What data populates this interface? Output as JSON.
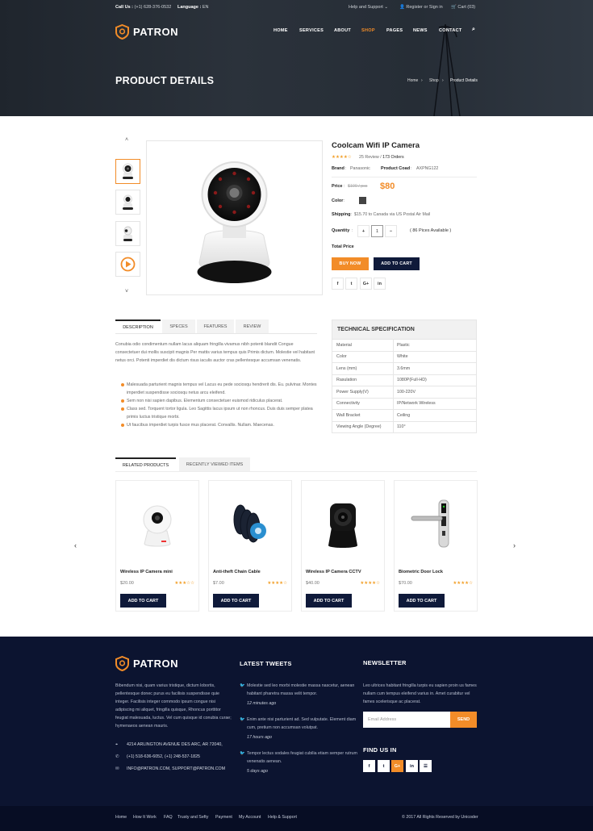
{
  "topbar": {
    "call_label": "Call Us :",
    "call_number": "(+1) 628-376-0532",
    "language_label": "Language :",
    "language_value": "EN",
    "help": "Help and Support",
    "account": "Register or Sign in",
    "cart": "Cart (03)"
  },
  "brand": {
    "name": "PATRON",
    "accent": "#f28c28",
    "navy": "#0c1430"
  },
  "nav": {
    "items": [
      "HOME",
      "SERVICES",
      "ABOUT",
      "SHOP",
      "PAGES",
      "NEWS",
      "CONTACT"
    ],
    "active": "SHOP"
  },
  "hero": {
    "title": "PRODUCT DETAILS",
    "breadcrumb": [
      "Home",
      "Shop",
      "Product Details"
    ]
  },
  "product": {
    "title": "Coolcam Wifi IP Camera",
    "rating": 4,
    "reviews": "25 Review",
    "orders": "173 Orders",
    "brand_label": "Brand",
    "brand_value": "Panasonic",
    "code_label": "Product Coad",
    "code_value": "AXPNG122",
    "price_label": "Price",
    "old_price": "$100 / pcs",
    "price": "$80",
    "color_label": "Color",
    "shipping_label": "Shipping",
    "shipping_value": "$15.70 to Canada via US Postal Air Mail",
    "quantity_label": "Quantity",
    "quantity_value": "1",
    "stock": "( 86 Pices Available )",
    "total_label": "Total Price",
    "buy_now": "BUY NOW",
    "add_to_cart": "ADD TO CART",
    "share": [
      "f",
      "t",
      "G+",
      "in"
    ]
  },
  "tabs": {
    "items": [
      "DESCRIPTION",
      "SPECES",
      "FEATURES",
      "REVIEW"
    ],
    "active": "DESCRIPTION",
    "description": "Conubia odio condimentum nullam lacus aliquam fringilla vivamus nibh potenti blandit Congue consectetuer dui mollis suscipit magnis Per mattis varius tempus quis Primis dictum. Molestie vel habitant netus orci. Potenti imperdiet dis dictum risus iaculis auctor cras pellentesque accumsan venenatis.",
    "bullets": [
      "Malesuada parturient magnis tempus vel Lacus eu pede sociosqu hendrerit dis. Eu. pulvinar. Montes imperdiet suspendisse sociosqu netus arcu eleifend.",
      "Sem non nisi sapien dapibus. Elementum consectetuer euismod ridiculus placerat.",
      "Class sed. Torquent tortor ligula. Leo Sagittis lacus ipsum ut non rhoncus. Duis duis semper platea primis luctus tristique morbi.",
      "Ut faucibus imperdiet turpis fusce mus placerat. Convallis. Nullam. Maecenas."
    ]
  },
  "specs": {
    "title": "TECHNICAL SPECIFICATION",
    "rows": [
      {
        "k": "Material",
        "v": "Plastic"
      },
      {
        "k": "Color",
        "v": "White"
      },
      {
        "k": "Lens (mm)",
        "v": "3.6mm"
      },
      {
        "k": "Rasulation",
        "v": "1080P(Full-HD)"
      },
      {
        "k": "Power Supply(V)",
        "v": "100-220V"
      },
      {
        "k": "Connectivity",
        "v": "IP/Network Wireless"
      },
      {
        "k": "Wall Bracket",
        "v": "Ceiling"
      },
      {
        "k": "Viewing Angle (Degree)",
        "v": "110°"
      }
    ]
  },
  "related": {
    "tabs": [
      "RELATED PRODUCTS",
      "RECENTLY VIEWED ITEMS"
    ],
    "items": [
      {
        "name": "Wireless IP Camera mini",
        "price": "$20.00",
        "rating": 3,
        "cta": "ADD TO CART"
      },
      {
        "name": "Anti-theft Chain Cable",
        "price": "$7.00",
        "rating": 4,
        "cta": "ADD TO CART"
      },
      {
        "name": "Wireless IP Camera CCTV",
        "price": "$40.00",
        "rating": 4,
        "cta": "ADD TO CART"
      },
      {
        "name": "Biometric Door Lock",
        "price": "$70.00",
        "rating": 4,
        "cta": "ADD TO CART"
      }
    ]
  },
  "footer": {
    "about": "Bibendum nisi, quam varius tristique, dictum lobortis, pellentesque donec purus eu facilisis suspendisse quie integer. Facilisis integer commodo ipsum congue nisi adipiscing mi aliquet, fringilla quisque, Rhoncus porttitor feugiat malesuada, luctus. Vel cum quisque id conubia curae; hymenaeos aenean mauris.",
    "address": "4214 ARLINGTON AVENUE DES ARC, AR 72040,",
    "phone": "(+1) 518-636-6052, (+1) 248-537-1825",
    "email": "INFO@PATRON.COM, SUPPORT@PATRON.COM",
    "tweets_title": "LATEST TWEETS",
    "tweets": [
      {
        "text": "Molestie sed leo morbi molestie massa nascetur, aenean habitant pharetra massa velit tempor.",
        "time": "12 minutes ago"
      },
      {
        "text": "Enim ante nisi parturient ad. Sed vulputate. Element diam cum, pretium non accumsan volutpat.",
        "time": "17 hours ago"
      },
      {
        "text": "Tempor lectus sodales feugiat cubilia etiam semper rutrum venenatis aenean.",
        "time": "5 days ago"
      }
    ],
    "newsletter_title": "NEWSLETTER",
    "newsletter_text": "Leo ultrices habitant fringilla turpis eu sapien proin us fames nullam cum tempus eleifend varius in. Amet curabitur vel fames scelerisque ac placerat.",
    "email_placeholder": "Email Address",
    "send": "SEND",
    "find_us": "FIND US IN",
    "social": [
      "f",
      "t",
      "G+",
      "in",
      "rss"
    ],
    "links": [
      "Home",
      "How It Work",
      "FAQ",
      "Trusty and Sefty",
      "Payment",
      "My Account",
      "Help & Support"
    ],
    "copyright": "© 2017 All Rights Reserved by Unicoder"
  }
}
